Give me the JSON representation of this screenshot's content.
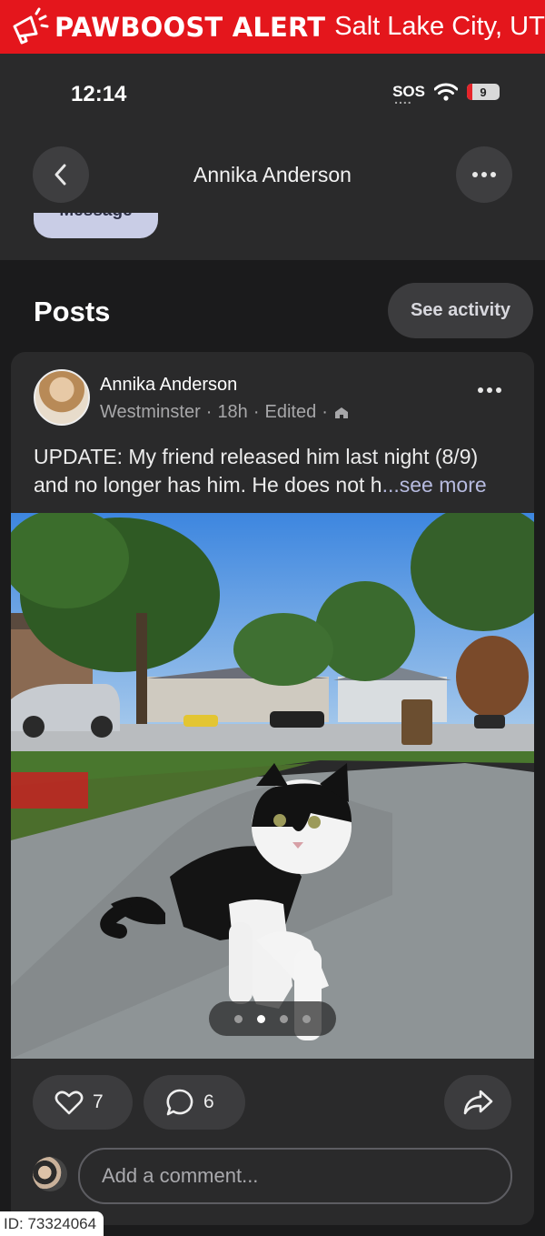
{
  "banner": {
    "brand": "PAWBOOST ALERT",
    "city": "Salt Lake City, UT",
    "color": "#e4161c"
  },
  "status_bar": {
    "time": "12:14",
    "sos": "SOS",
    "battery": "9"
  },
  "header": {
    "profile_name": "Annika Anderson",
    "message_button": "Message"
  },
  "posts_section": {
    "title": "Posts",
    "see_activity": "See activity"
  },
  "post": {
    "author": "Annika Anderson",
    "location": "Westminster",
    "age": "18h",
    "edited": "Edited",
    "text": "UPDATE: My friend released him last night (8/9) and no longer has him. He does not h",
    "see_more": "...see more",
    "carousel": {
      "count": 4,
      "active_index": 1
    },
    "likes": "7",
    "comments": "6"
  },
  "comment_box": {
    "placeholder": "Add a comment..."
  },
  "footer": {
    "id": "ID: 73324064"
  }
}
